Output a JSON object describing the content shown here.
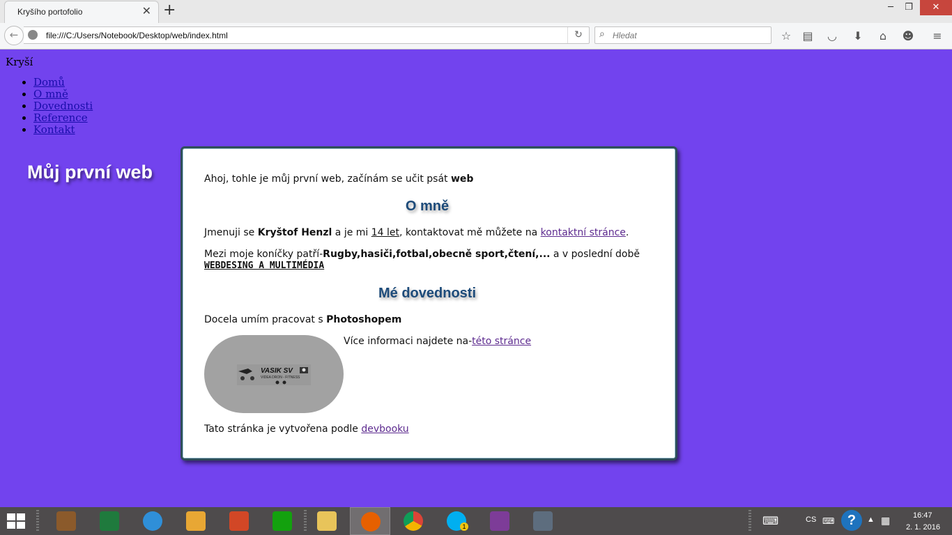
{
  "browser": {
    "tab_title": "Kryšího portofolio",
    "tab_close": "✕",
    "new_tab": "+",
    "window_controls": {
      "minimize": "─",
      "restore": "❐",
      "close": "✕"
    },
    "url": "file:///C:/Users/Notebook/Desktop/web/index.html",
    "search_placeholder": "Hledat",
    "toolbar_icons": [
      "star-icon",
      "reading-list-icon",
      "pocket-icon",
      "download-icon",
      "home-icon",
      "hello-icon",
      "menu-icon"
    ]
  },
  "page": {
    "brand": "Kryší",
    "nav": [
      "Domů",
      "O mně",
      "Dovednosti",
      "Reference",
      "Kontakt"
    ],
    "heading": "Můj první web",
    "intro_text": "Ahoj, tohle je můj první web, začínám se učit psát ",
    "intro_bold": "web",
    "about_heading": "O mně",
    "about_p1_a": "Jmenuji se ",
    "about_p1_name": "Kryštof Henzl",
    "about_p1_b": " a je mi ",
    "about_p1_age": "14 let",
    "about_p1_c": ", kontaktovat mě můžete na ",
    "about_p1_link": "kontaktní stránce",
    "about_p1_end": ".",
    "about_p2_a": "Mezi moje koníčky patří-",
    "about_p2_bold": "Rugby,hasiči,fotbal,obecně sport,čtení,...",
    "about_p2_b": " a v poslední době",
    "about_p2_strong": "WEBDESING A MULTIMÉDIA",
    "skills_heading": "Mé dovednosti",
    "skills_p_a": "Docela umím pracovat s ",
    "skills_p_bold": "Photoshopem",
    "more_info_a": "Více informaci najdete na-",
    "more_info_link": "této stránce",
    "logo_title": "VASIK SV",
    "logo_sub": "VIDEA DRON - FITNESS",
    "footer_a": "Tato stránka je vytvořena podle ",
    "footer_link": "devbooku"
  },
  "taskbar": {
    "apps": [
      "video-editor-icon",
      "excel-icon",
      "internet-explorer-icon",
      "outlook-icon",
      "powerpoint-icon",
      "store-icon",
      "file-explorer-icon",
      "firefox-icon",
      "chrome-icon",
      "skype-icon",
      "winrar-icon",
      "pen-tool-icon"
    ],
    "active_app": "firefox-icon",
    "language": "CS",
    "time": "16:47",
    "date": "2. 1. 2016",
    "skype_badge": "1"
  },
  "colors": {
    "page_background": "#7243ee",
    "link": "#5d2b8f",
    "nav_link": "#1a0dab",
    "heading_blue": "#1d4b7a",
    "taskbar": "#4e4b4c"
  }
}
